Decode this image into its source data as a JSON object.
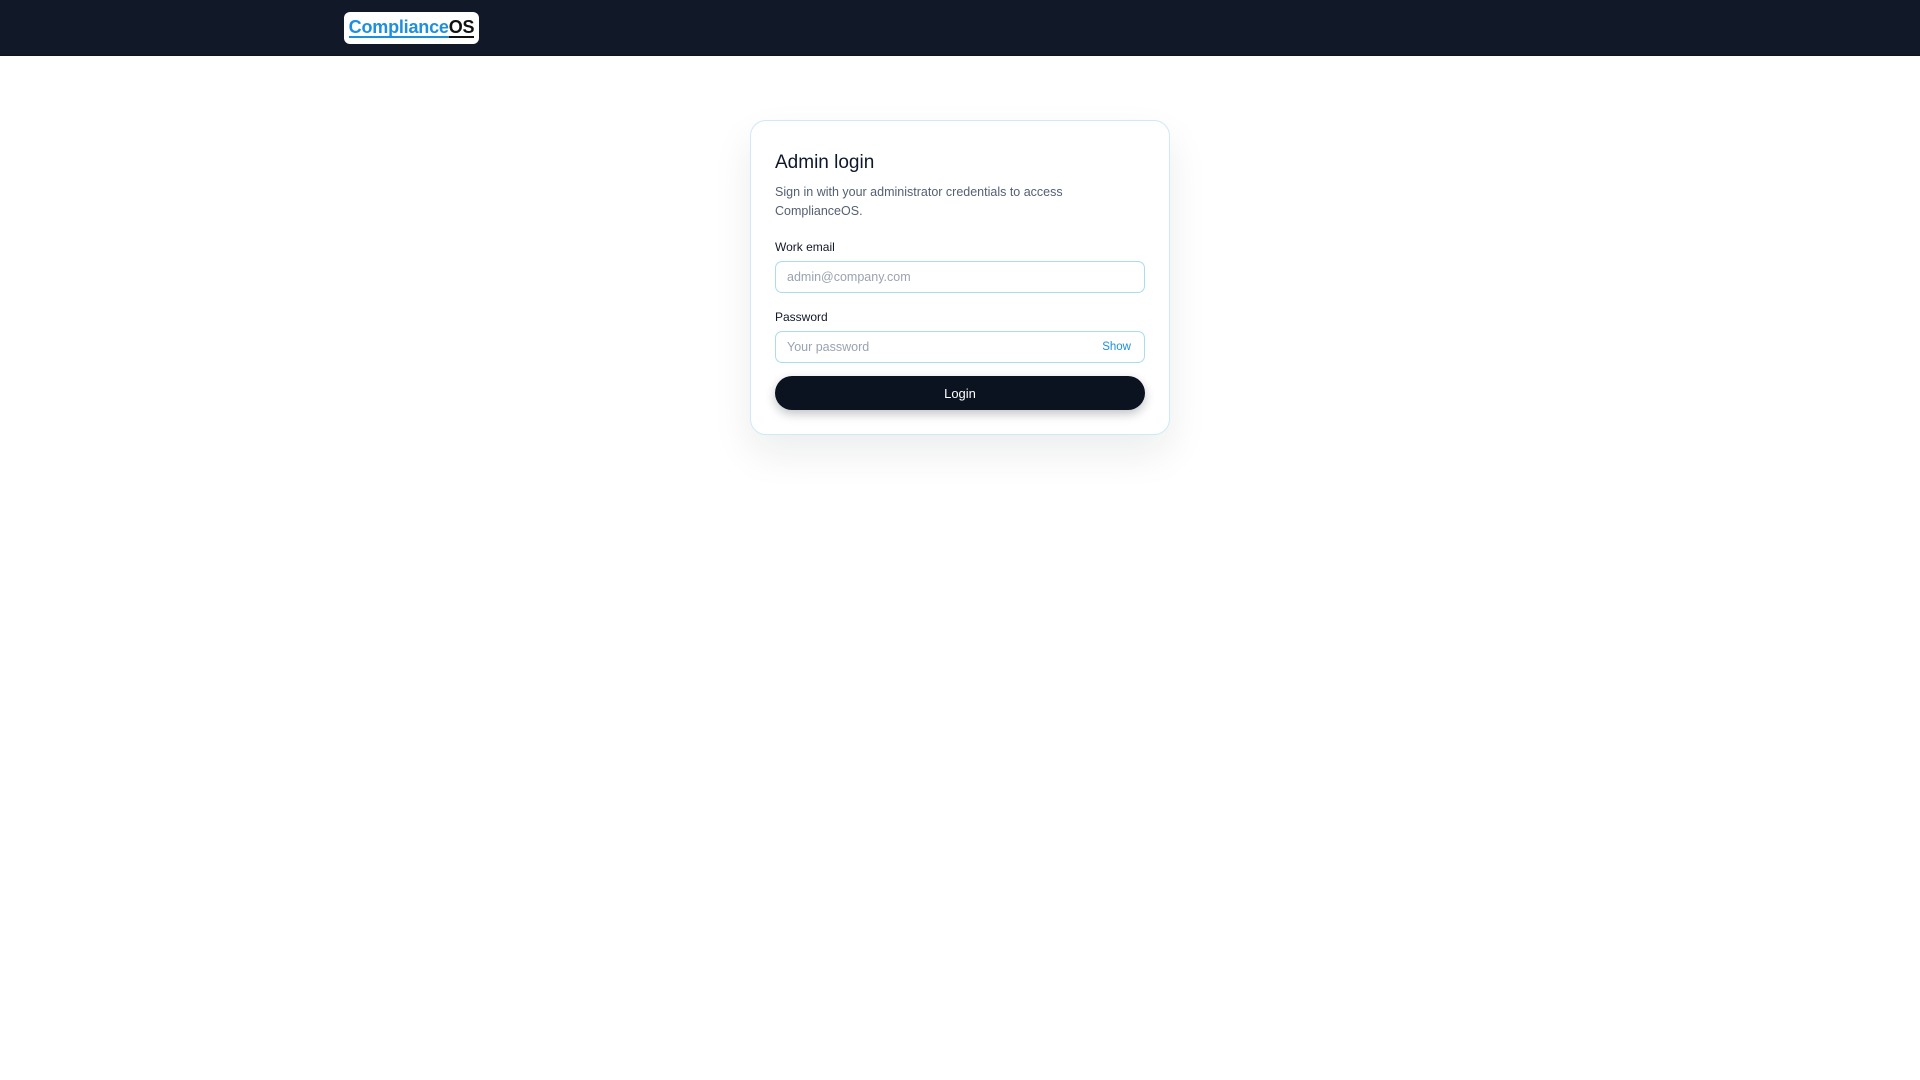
{
  "header": {
    "logo": {
      "part_a": "Compliance",
      "part_b": "OS"
    }
  },
  "login_card": {
    "title": "Admin login",
    "subtitle": "Sign in with your administrator credentials to access ComplianceOS.",
    "email": {
      "label": "Work email",
      "value": "",
      "placeholder": "admin@company.com"
    },
    "password": {
      "label": "Password",
      "value": "",
      "placeholder": "Your password",
      "toggle_label": "Show"
    },
    "submit_label": "Login"
  },
  "colors": {
    "header_bg": "#111827",
    "accent": "#1d8fe0",
    "button_bg": "#0b1220",
    "input_border": "#a9dced"
  }
}
